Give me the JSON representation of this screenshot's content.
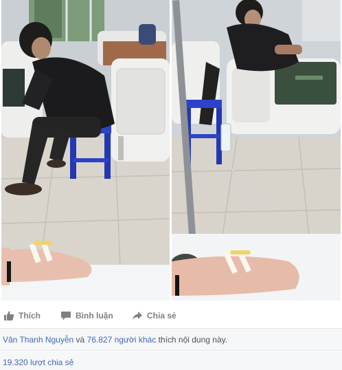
{
  "post": {
    "actions": {
      "like_label": "Thích",
      "comment_label": "Bình luận",
      "share_label": "Chia sẻ"
    },
    "likes": {
      "first_name": "Vân Thanh Nguyễn",
      "and_word": "và",
      "others": "76.827 người khác",
      "suffix": "thích nội dung này."
    },
    "shares_label": "19.320 lượt chia sẻ"
  },
  "colors": {
    "link": "#4267b2",
    "action_text": "#7f7f7f",
    "footer_bg": "#f6f7f9"
  },
  "icons": {
    "like": "thumbs-up-icon",
    "comment": "speech-bubble-icon",
    "share": "share-arrow-icon"
  }
}
